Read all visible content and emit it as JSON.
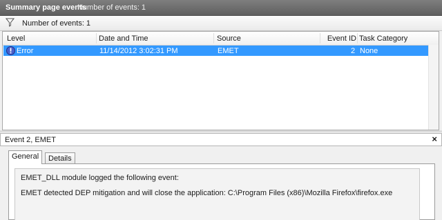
{
  "header": {
    "title": "Summary page events",
    "count_label": "Number of events: 1"
  },
  "filterbar": {
    "label": "Number of events: 1",
    "icon": "filter-icon"
  },
  "grid": {
    "columns": [
      "Level",
      "Date and Time",
      "Source",
      "Event ID",
      "Task Category"
    ],
    "rows": [
      {
        "level": "Error",
        "datetime": "11/14/2012 3:02:31 PM",
        "source": "EMET",
        "event_id": "2",
        "task_category": "None",
        "icon": "error-icon"
      }
    ],
    "selected_color": "#3399ff"
  },
  "details": {
    "title": "Event 2, EMET",
    "close_glyph": "×",
    "tabs": [
      {
        "label": "General",
        "active": true
      },
      {
        "label": "Details",
        "active": false
      }
    ],
    "message_line1": "EMET_DLL module logged the following event:",
    "message_line2": "EMET detected DEP mitigation and will close the application: C:\\Program Files (x86)\\Mozilla Firefox\\firefox.exe"
  }
}
